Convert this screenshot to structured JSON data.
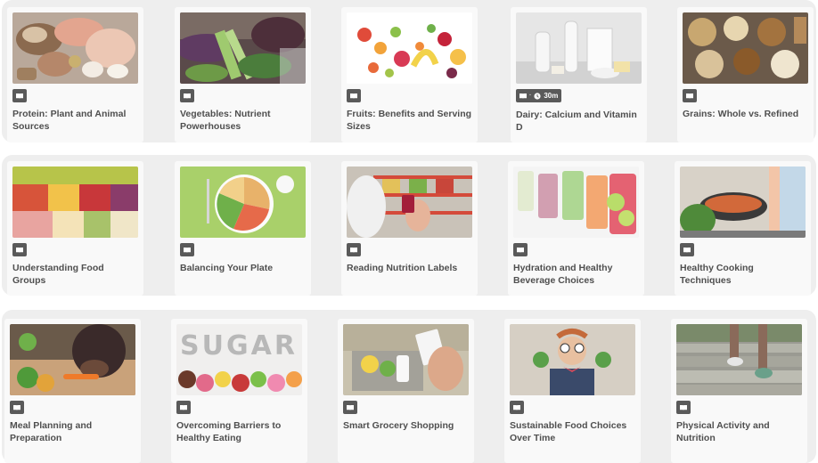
{
  "rows": [
    {
      "cards": [
        {
          "title": "Protein: Plant and Animal Sources",
          "image": "protein-foods"
        },
        {
          "title": "Vegetables: Nutrient Powerhouses",
          "image": "vegetables"
        },
        {
          "title": "Fruits: Benefits and Serving Sizes",
          "image": "fruits"
        },
        {
          "title": "Dairy: Calcium and Vitamin D",
          "image": "dairy",
          "duration": "30m"
        },
        {
          "title": "Grains: Whole vs. Refined",
          "image": "grains"
        }
      ]
    },
    {
      "cards": [
        {
          "title": "Understanding Food Groups",
          "image": "food-groups"
        },
        {
          "title": "Balancing Your Plate",
          "image": "plate"
        },
        {
          "title": "Reading Nutrition Labels",
          "image": "grocery-shelf"
        },
        {
          "title": "Hydration and Healthy Beverage Choices",
          "image": "infused-water"
        },
        {
          "title": "Healthy Cooking Techniques",
          "image": "cooking"
        }
      ]
    },
    {
      "cards": [
        {
          "title": "Meal Planning and Preparation",
          "image": "chopping-vegetables"
        },
        {
          "title": "Overcoming Barriers to Healthy Eating",
          "image": "sugar",
          "image_text": "SUGAR"
        },
        {
          "title": "Smart Grocery Shopping",
          "image": "grocery-cart"
        },
        {
          "title": "Sustainable Food Choices Over Time",
          "image": "child-broccoli"
        },
        {
          "title": "Physical Activity and Nutrition",
          "image": "stairs-running"
        }
      ]
    }
  ],
  "badge_icon": "book-icon",
  "duration_separator": "·",
  "duration_icon": "clock-icon"
}
